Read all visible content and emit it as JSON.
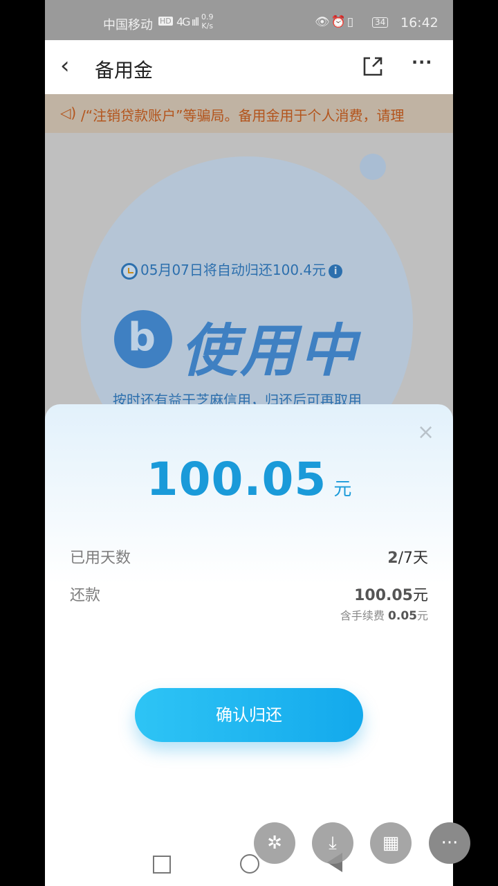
{
  "status_bar": {
    "carrier": "中国移动",
    "hd": "HD",
    "signal": "4G ııll",
    "speed_value": "0.9",
    "speed_unit": "K/s",
    "battery": "34",
    "time": "16:42"
  },
  "nav": {
    "title": "备用金"
  },
  "notice": {
    "text": "/“注销贷款账户”等骗局。备用金用于个人消费，请理"
  },
  "card": {
    "auto_return": "05月07日将自动归还100.4元",
    "status": "使用中",
    "subtitle": "按时还有益于芝麻信用，归还后可再取用"
  },
  "sheet": {
    "close": "×",
    "amount": "100.05",
    "amount_unit": "元",
    "days_label": "已用天数",
    "days_used": "2",
    "days_total": "/7天",
    "repay_label": "还款",
    "repay_value": "100.05",
    "repay_unit": "元",
    "fee_label": "含手续费",
    "fee_value": "0.05",
    "fee_unit": "元",
    "confirm_label": "确认归还"
  },
  "icons": {
    "back": "chevron-left-icon",
    "share": "share-icon",
    "more": "more-icon",
    "speaker": "speaker-icon"
  },
  "colors": {
    "accent": "#1a9ad9",
    "notice": "#b3541c"
  }
}
